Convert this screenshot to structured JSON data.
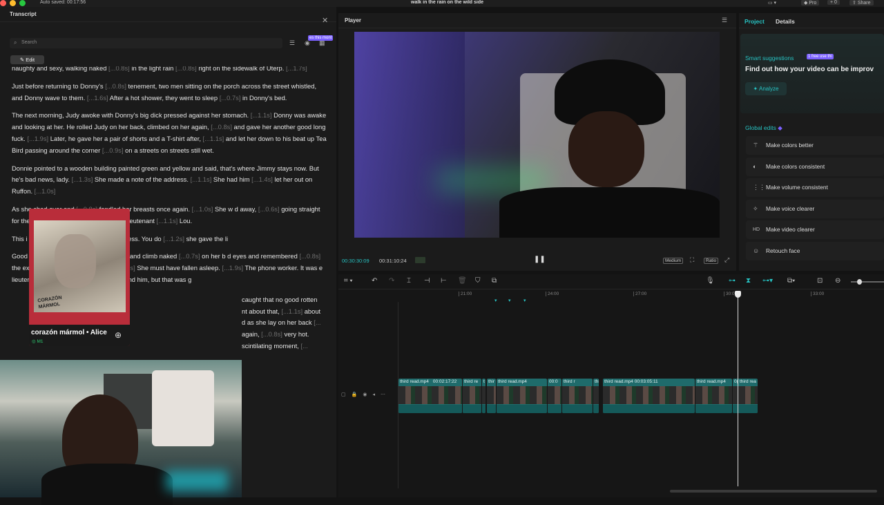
{
  "titlebar": {
    "autosave": "Auto saved: 00:17:56",
    "title": "walk in the rain on the wild side",
    "pro": "Pro",
    "counter": "0",
    "share": "Share"
  },
  "transcript": {
    "title": "Transcript",
    "search_placeholder": "Search",
    "tooltip": "es this mont",
    "edit_label": "Edit",
    "paragraphs": [
      [
        {
          "t": "naughty and sexy, walking naked "
        },
        {
          "t": "[...0.8s]",
          "g": 1
        },
        {
          "t": " in the light rain "
        },
        {
          "t": "[...0.8s]",
          "g": 1
        },
        {
          "t": " right on the sidewalk of Uterp. "
        },
        {
          "t": "[...1.7s]",
          "g": 1
        }
      ],
      [
        {
          "t": "Just before returning to Donny's "
        },
        {
          "t": "[...0.8s]",
          "g": 1
        },
        {
          "t": " tenement, two men sitting on the porch across the street whistled, and Donny wave to them. "
        },
        {
          "t": "[...1.6s]",
          "g": 1
        },
        {
          "t": " After a hot shower, they went to sleep "
        },
        {
          "t": "[...0.7s]",
          "g": 1
        },
        {
          "t": " in Donny's bed."
        }
      ],
      [
        {
          "t": "The next morning, Judy awoke with Donny's big dick pressed against her stomach. "
        },
        {
          "t": "[...1.1s]",
          "g": 1
        },
        {
          "t": " Donny was awake and looking at her. He rolled Judy on her back, climbed on her again, "
        },
        {
          "t": "[...0.8s]",
          "g": 1
        },
        {
          "t": " and gave her another good long fuck. "
        },
        {
          "t": "[...1.9s]",
          "g": 1
        },
        {
          "t": " Later, he gave her a pair of shorts and a T-shirt after, "
        },
        {
          "t": "[...1.1s]",
          "g": 1
        },
        {
          "t": " and let her down to his beat up Tea Bird passing around the corner "
        },
        {
          "t": "[...0.9s]",
          "g": 1
        },
        {
          "t": " on a streets on streets still wet."
        }
      ],
      [
        {
          "t": "Donnie pointed to a wooden building painted green and yellow and said, that's where Jimmy stays now. But he's bad news, lady. "
        },
        {
          "t": "[...1.3s]",
          "g": 1
        },
        {
          "t": " She made a note of the address. "
        },
        {
          "t": "[...1.1s]",
          "g": 1
        },
        {
          "t": " She had him "
        },
        {
          "t": "[...1.4s]",
          "g": 1
        },
        {
          "t": " let her out on Ruffon. "
        },
        {
          "t": "[...1.0s]",
          "g": 1
        }
      ],
      [
        {
          "t": "As she "
        },
        {
          "t": "",
          "g": 0
        },
        {
          "t": "ched over and "
        },
        {
          "t": "[...0.8s]",
          "g": 1
        },
        {
          "t": " fondled her breasts once again. "
        },
        {
          "t": "[...1.0s]",
          "g": 1
        },
        {
          "t": " She w                                         d away, "
        },
        {
          "t": "[...0.6s]",
          "g": 1
        },
        {
          "t": " going straight for the telephone. Judy called homic                                         for lieutenant "
        },
        {
          "t": "[...1.1s]",
          "g": 1
        },
        {
          "t": " Lou."
        }
      ],
      [
        {
          "t": "This i                                          patrol. I have Jimmy Walker's address. You do "
        },
        {
          "t": "[...1.2s]",
          "g": 1
        },
        {
          "t": " she gave the li"
        }
      ],
      [
        {
          "t": "Good                                          im. Judy took another long shower and climb naked "
        },
        {
          "t": "[...0.7s]",
          "g": 1
        },
        {
          "t": " on her b                                          d eyes and remembered "
        },
        {
          "t": "[...0.8s]",
          "g": 1
        },
        {
          "t": " the excitement, the feeling of gettin                                          "
        },
        {
          "t": "[...1.0s]",
          "g": 1
        },
        {
          "t": " She must have fallen asleep. "
        },
        {
          "t": "[...1.9s]",
          "g": 1
        },
        {
          "t": " The phone worker. It was                                          e lieutenant said. I don't know how you found him, but that was g"
        }
      ],
      [
        {
          "t": "caught that no good rotten"
        }
      ],
      [
        {
          "t": "nt about that, "
        },
        {
          "t": "[...1.1s]",
          "g": 1
        },
        {
          "t": " about"
        }
      ],
      [
        {
          "t": "d as she lay on her back "
        },
        {
          "t": "[...",
          "g": 1
        }
      ],
      [
        {
          "t": " again, "
        },
        {
          "t": "[...0.8s]",
          "g": 1
        },
        {
          "t": " very hot."
        }
      ],
      [
        {
          "t": "scintilating moment, "
        },
        {
          "t": "[...",
          "g": 1
        }
      ]
    ]
  },
  "music_card": {
    "album_line1": "CORAZÓN",
    "album_line2": "MÁRMOL",
    "title": "corazón mármol • Alice",
    "sub": "M1"
  },
  "player": {
    "title": "Player",
    "current_time": "00:30:30:09",
    "total_time": "00:31:10:24",
    "quality": "Medium",
    "ratio": "Ratio"
  },
  "right_panel": {
    "tabs": [
      "Project",
      "Details"
    ],
    "smart_title": "Smart suggestions",
    "smart_badge": "1 free use thi",
    "smart_desc": "Find out how your video can be improv",
    "analyze": "Analyze",
    "global_title": "Global edits",
    "global_items": [
      {
        "label": "Make colors better",
        "icon": "wand-icon"
      },
      {
        "label": "Make colors consistent",
        "icon": "palette-icon"
      },
      {
        "label": "Make volume consistent",
        "icon": "volume-levels-icon"
      },
      {
        "label": "Make voice clearer",
        "icon": "sparkle-icon"
      },
      {
        "label": "Make video clearer",
        "icon": "hd-icon"
      },
      {
        "label": "Retouch face",
        "icon": "face-icon"
      }
    ]
  },
  "timeline": {
    "ruler": [
      "21:00",
      "24:00",
      "27:00",
      "30:0",
      "33:00"
    ],
    "clips": [
      {
        "label": "third read.mp4"
      },
      {
        "label": "00:02:17:22"
      },
      {
        "label": "third re"
      },
      {
        "label": "t"
      },
      {
        "label": "thir"
      },
      {
        "label": "third read.mp4"
      },
      {
        "label": "00:0"
      },
      {
        "label": "third r"
      },
      {
        "label": "third read.mp4"
      },
      {
        "label": "third read.mp4  00:03:05:11"
      },
      {
        "label": "third read.mp4"
      },
      {
        "label": "0("
      },
      {
        "label": "third rea"
      }
    ]
  },
  "colors": {
    "accent": "#27c3c3",
    "purple": "#7b61ff",
    "bg": "#1b1b1b"
  }
}
